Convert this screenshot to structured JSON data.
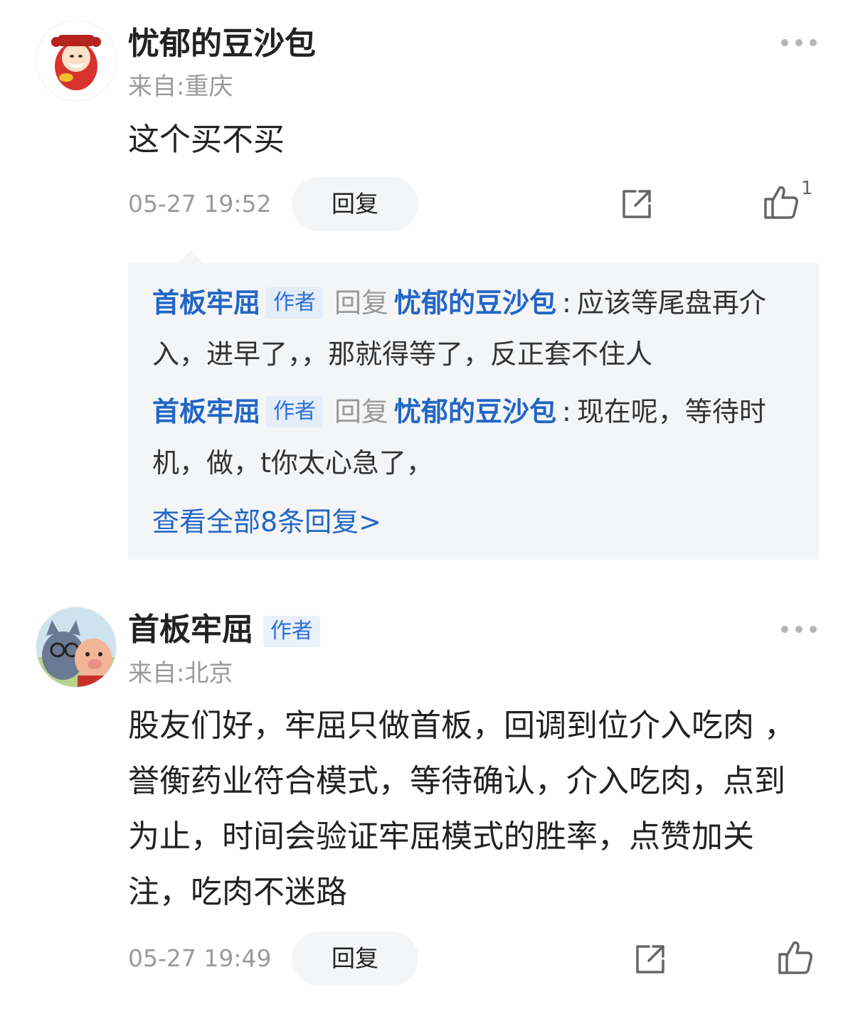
{
  "comments": [
    {
      "username": "忧郁的豆沙包",
      "location": "来自:重庆",
      "content": "这个买不买",
      "time": "05-27 19:52",
      "reply_label": "回复",
      "like_count": "1",
      "icons": [
        "more-icon",
        "share-icon",
        "thumbs-up-icon"
      ],
      "sub_replies": [
        {
          "from": "首板牢屈",
          "from_tag": "作者",
          "verb": "回复",
          "to": "忧郁的豆沙包",
          "separator": ":",
          "text": "应该等尾盘再介入，进早了，，那就得等了，反正套不住人"
        },
        {
          "from": "首板牢屈",
          "from_tag": "作者",
          "verb": "回复",
          "to": "忧郁的豆沙包",
          "separator": ":",
          "text": "现在呢，等待时机，做，t你太心急了，"
        }
      ],
      "view_all": "查看全部8条回复>"
    },
    {
      "username": "首板牢屈",
      "author_tag": "作者",
      "location": "来自:北京",
      "content": "股友们好，牢屈只做首板，回调到位介入吃肉 ，誉衡药业符合模式，等待确认，介入吃肉，点到为止，时间会验证牢屈模式的胜率，点赞加关注，吃肉不迷路",
      "time": "05-27 19:49",
      "reply_label": "回复",
      "icons": [
        "more-icon",
        "share-icon",
        "thumbs-up-icon"
      ]
    }
  ],
  "colors": {
    "link_blue": "#2266c6",
    "tag_bg": "#e9f1fb",
    "muted": "#9a9a9a",
    "panel_bg": "#f4f5f7"
  }
}
